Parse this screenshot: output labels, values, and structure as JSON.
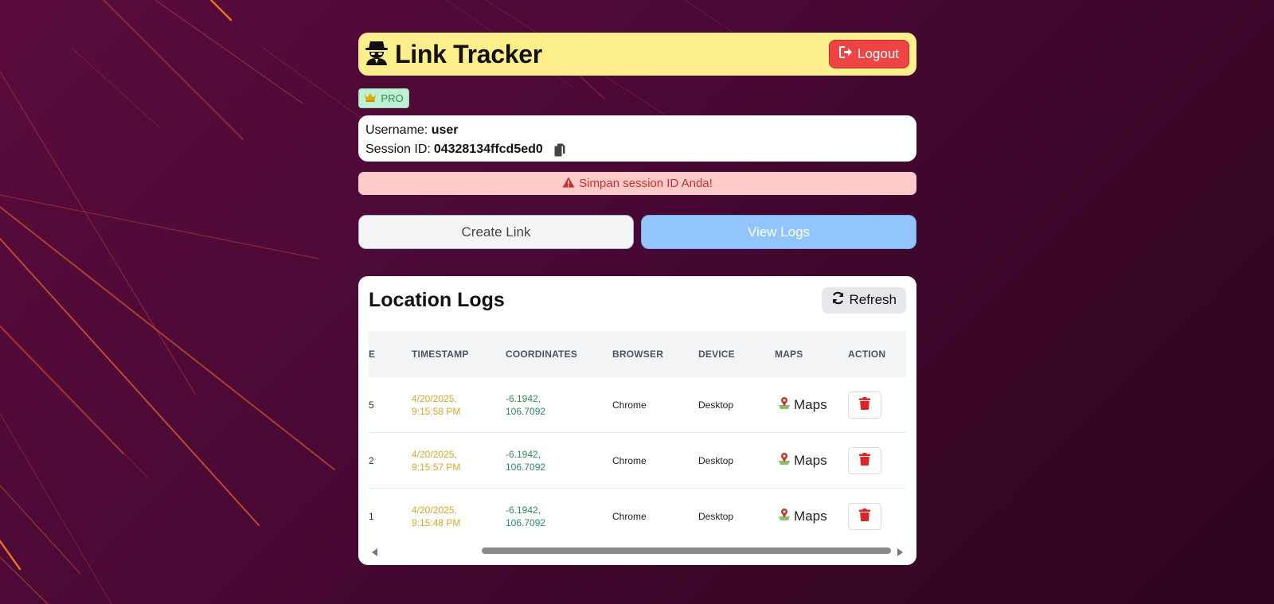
{
  "header": {
    "title": "Link Tracker",
    "logout_label": "Logout"
  },
  "badge": {
    "label": "PRO"
  },
  "user": {
    "username_label": "Username:",
    "username": "user",
    "session_label": "Session ID:",
    "session_id": "04328134ffcd5ed0"
  },
  "warning": {
    "text": "Simpan session ID Anda!"
  },
  "nav": {
    "create_label": "Create Link",
    "view_label": "View Logs"
  },
  "logs": {
    "title": "Location Logs",
    "refresh_label": "Refresh",
    "columns": [
      "E",
      "TIMESTAMP",
      "COORDINATES",
      "BROWSER",
      "DEVICE",
      "MAPS",
      "ACTION"
    ],
    "rows": [
      {
        "id": "5",
        "ts1": "4/20/2025,",
        "ts2": "9:15:58 PM",
        "c1": "-6.1942,",
        "c2": "106.7092",
        "browser": "Chrome",
        "device": "Desktop",
        "maps": "Maps"
      },
      {
        "id": "2",
        "ts1": "4/20/2025,",
        "ts2": "9:15:57 PM",
        "c1": "-6.1942,",
        "c2": "106.7092",
        "browser": "Chrome",
        "device": "Desktop",
        "maps": "Maps"
      },
      {
        "id": "1",
        "ts1": "4/20/2025,",
        "ts2": "9:15:48 PM",
        "c1": "-6.1942,",
        "c2": "106.7092",
        "browser": "Chrome",
        "device": "Desktop",
        "maps": "Maps"
      }
    ]
  },
  "colors": {
    "header_bg": "#fdef8c",
    "logout_bg": "#ef4444",
    "timestamp": "#d4a72c",
    "coordinates": "#2e8b57",
    "delete_icon": "#dc2626"
  }
}
